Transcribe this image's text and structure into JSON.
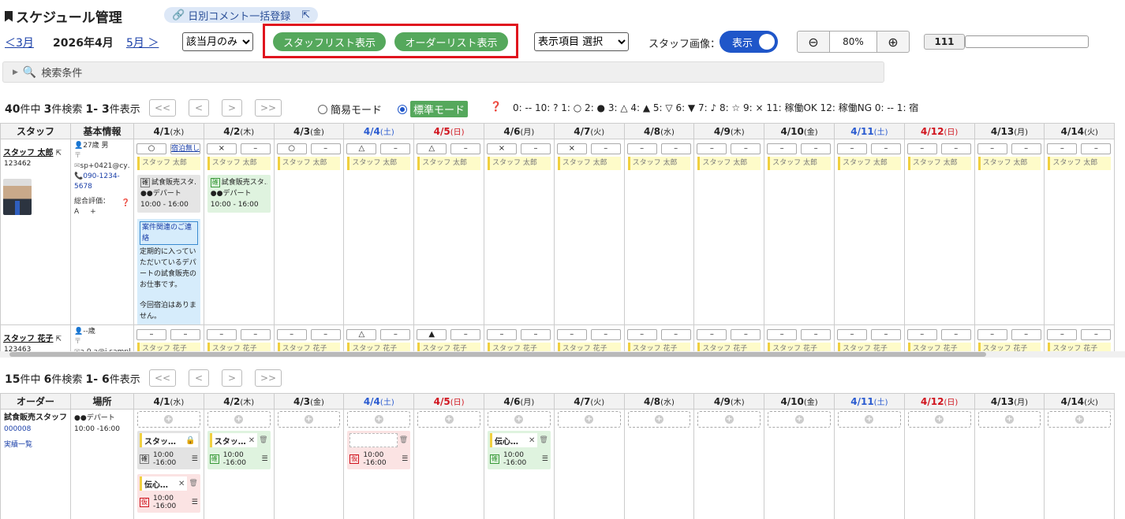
{
  "header": {
    "title": "スケジュール管理",
    "bulk_comment": "日別コメント一括登録",
    "prev_month": "＜3月",
    "current_month": "2026年4月",
    "next_month": "5月 ＞",
    "month_filter": "該当月のみ",
    "staff_list_btn": "スタッフリスト表示",
    "order_list_btn": "オーダーリスト表示",
    "display_items": "表示項目 選択",
    "staff_image_label": "スタッフ画像：",
    "staff_image_toggle": "表示",
    "zoom_value": "80%",
    "counter_value": "111"
  },
  "search": {
    "label": "検索条件"
  },
  "staff_section": {
    "total": "40",
    "total_suffix": "件中 ",
    "found": "3",
    "found_suffix": "件検索 ",
    "range": "1- 3",
    "range_suffix": "件表示",
    "pager": [
      "<<",
      "<",
      ">",
      ">>"
    ],
    "mode_simple": "簡易モード",
    "mode_standard": "標準モード",
    "legend": "0: --    10: ?    1: ○    2: ●    3: △    4: ▲    5: ▽    6: ▼    7: ♪    8: ☆    9: ×    11: 稼働OK    12: 稼働NG      0: --    1: 宿",
    "col_staff": "スタッフ",
    "col_basic": "基本情報"
  },
  "days": [
    {
      "date": "4/1",
      "dow": "(水)",
      "type": "wd"
    },
    {
      "date": "4/2",
      "dow": "(木)",
      "type": "wd"
    },
    {
      "date": "4/3",
      "dow": "(金)",
      "type": "wd"
    },
    {
      "date": "4/4",
      "dow": "(土)",
      "type": "sat"
    },
    {
      "date": "4/5",
      "dow": "(日)",
      "type": "sun"
    },
    {
      "date": "4/6",
      "dow": "(月)",
      "type": "wd"
    },
    {
      "date": "4/7",
      "dow": "(火)",
      "type": "wd"
    },
    {
      "date": "4/8",
      "dow": "(水)",
      "type": "wd"
    },
    {
      "date": "4/9",
      "dow": "(木)",
      "type": "wd"
    },
    {
      "date": "4/10",
      "dow": "(金)",
      "type": "wd"
    },
    {
      "date": "4/11",
      "dow": "(土)",
      "type": "sat"
    },
    {
      "date": "4/12",
      "dow": "(日)",
      "type": "sun"
    },
    {
      "date": "4/13",
      "dow": "(月)",
      "type": "wd"
    },
    {
      "date": "4/14",
      "dow": "(火)",
      "type": "wd"
    }
  ],
  "staff": [
    {
      "name": "スタッフ 太郎",
      "id": "123462",
      "age": "27歳 男",
      "postal": "〒",
      "email": "sp+0421@cy…",
      "phone": "090-1234-5678",
      "rating_label": "総合評価",
      "rating": "：A",
      "rating_plus": "+",
      "marks": [
        "○",
        "×",
        "○",
        "△",
        "△",
        "×",
        "×",
        "–",
        "–",
        "–",
        "–",
        "–",
        "–",
        "–"
      ],
      "second": [
        "宿泊無し",
        "–",
        "–",
        "–",
        "–",
        "–",
        "–",
        "–",
        "–",
        "–",
        "–",
        "–",
        "–",
        "–"
      ],
      "chip": "スタッフ 太郎",
      "jobs": [
        {
          "day": 0,
          "tag": "確",
          "title": "試食販売スタ…",
          "place": "●●デパート",
          "time": "10:00 - 16:00",
          "color": "gray"
        },
        {
          "day": 1,
          "tag": "確",
          "title": "試食販売スタ…",
          "place": "●●デパート",
          "time": "10:00 - 16:00",
          "color": "green"
        }
      ],
      "note": {
        "tag": "案件関連のご連絡",
        "text1": "定期的に入っていただいているデパートの試食販売のお仕事です。",
        "text2": "今回宿泊はありません。"
      }
    },
    {
      "name": "スタッフ 花子",
      "id": "123463",
      "age": "--歳",
      "postal": "〒",
      "email": "a.0.a@i.sampl…",
      "marks": [
        "–",
        "–",
        "–",
        "△",
        "▲",
        "–",
        "–",
        "–",
        "–",
        "–",
        "–",
        "–",
        "–",
        "–"
      ],
      "second": [
        "–",
        "–",
        "–",
        "–",
        "–",
        "–",
        "–",
        "–",
        "–",
        "–",
        "–",
        "–",
        "–",
        "–"
      ],
      "chip": "スタッフ 花子"
    }
  ],
  "order_section": {
    "total": "15",
    "total_suffix": "件中 ",
    "found": "6",
    "found_suffix": "件検索 ",
    "range": "1- 6",
    "range_suffix": "件表示",
    "col_order": "オーダー",
    "col_place": "場所",
    "order": {
      "name": "試食販売スタッフ",
      "code": "000008",
      "link": "実績一覧",
      "place": "●●デパート",
      "time": "10:00 -16:00"
    },
    "cards": [
      {
        "day": 0,
        "name": "スタッ…",
        "icon": "lock",
        "tag": "確",
        "time": "10:00 -16:00",
        "color": "gray"
      },
      {
        "day": 0,
        "name": "伝心…",
        "icon": "x",
        "tag": "仮",
        "time": "10:00 -16:00",
        "color": "pink",
        "second": true
      },
      {
        "day": 1,
        "name": "スタッ…",
        "icon": "x",
        "tag": "確",
        "time": "10:00 -16:00",
        "color": "green"
      },
      {
        "day": 3,
        "name": "",
        "icon": "none",
        "tag": "仮",
        "time": "10:00 -16:00",
        "color": "pink"
      },
      {
        "day": 5,
        "name": "伝心…",
        "icon": "x",
        "tag": "確",
        "time": "10:00 -16:00",
        "color": "green"
      }
    ]
  }
}
